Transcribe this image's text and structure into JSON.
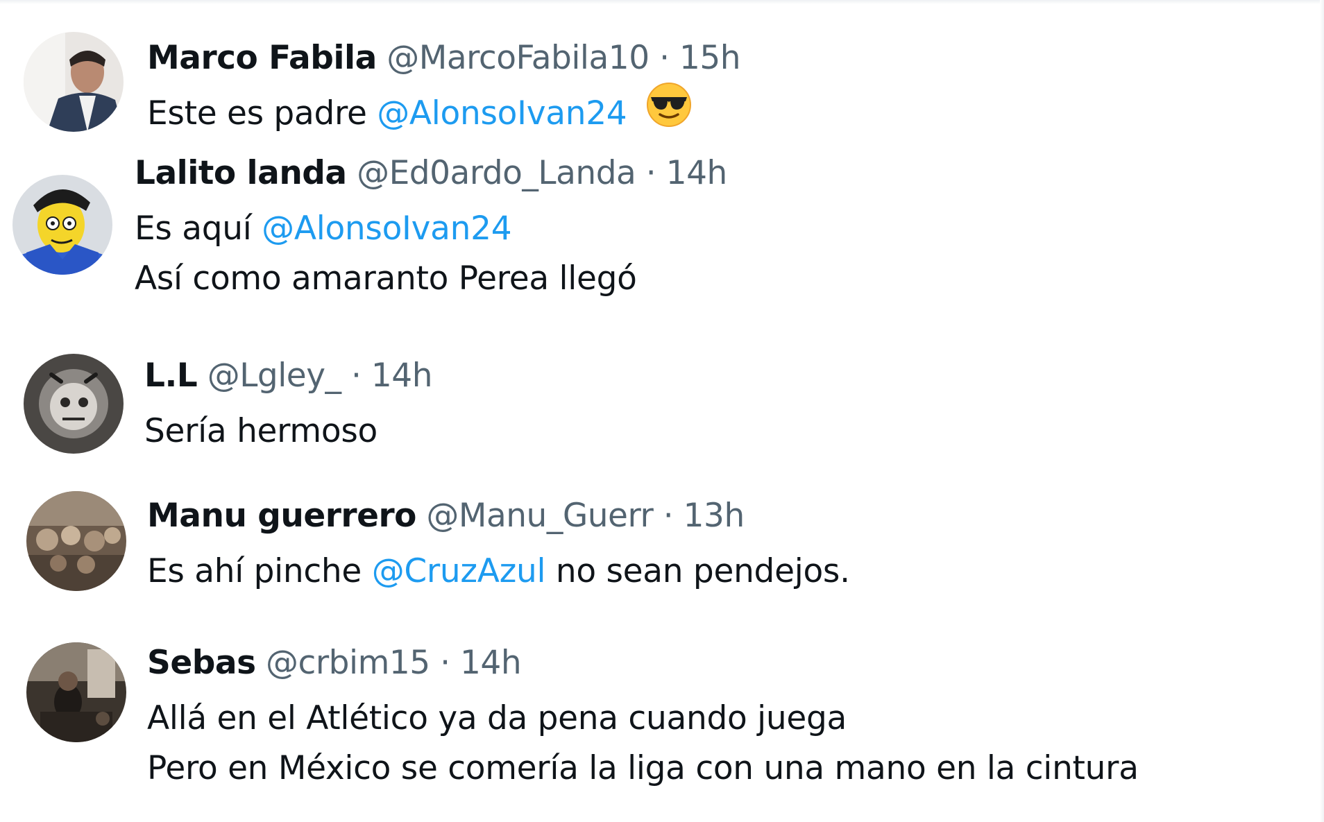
{
  "replies": [
    {
      "name": "Marco Fabila",
      "handle": "@MarcoFabila10",
      "separator": "·",
      "time": "15h",
      "lines": [
        {
          "before": "Este es padre ",
          "mention": "@AlonsoIvan24",
          "after": ""
        }
      ],
      "emoji": "smiling-face-with-sunglasses"
    },
    {
      "name": "Lalito landa",
      "handle": "@Ed0ardo_Landa",
      "separator": "·",
      "time": "14h",
      "lines": [
        {
          "before": "Es aquí ",
          "mention": "@AlonsoIvan24",
          "after": ""
        },
        {
          "before": "Así como amaranto Perea llegó",
          "mention": "",
          "after": ""
        }
      ]
    },
    {
      "name": "L.L",
      "handle": "@Lgley_",
      "separator": "·",
      "time": "14h",
      "lines": [
        {
          "before": "Sería hermoso",
          "mention": "",
          "after": ""
        }
      ]
    },
    {
      "name": "Manu guerrero",
      "handle": "@Manu_Guerr",
      "separator": "·",
      "time": "13h",
      "lines": [
        {
          "before": "Es ahí pinche ",
          "mention": "@CruzAzul",
          "after": " no sean pendejos."
        }
      ]
    },
    {
      "name": "Sebas",
      "handle": "@crbim15",
      "separator": "·",
      "time": "14h",
      "lines": [
        {
          "before": "Allá en el Atlético ya da pena cuando juega",
          "mention": "",
          "after": ""
        },
        {
          "before": "Pero en México se comería la liga con una mano en la cintura",
          "mention": "",
          "after": ""
        }
      ]
    }
  ],
  "colors": {
    "text": "#0f1419",
    "secondary": "#536471",
    "mention": "#1d9bf0"
  }
}
